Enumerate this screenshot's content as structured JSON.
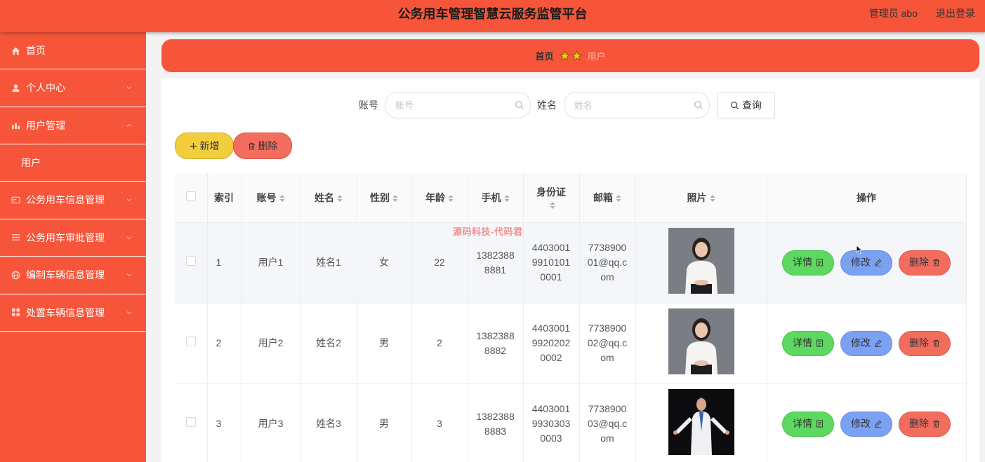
{
  "header": {
    "title": "公务用车管理智慧云服务监管平台",
    "user": "管理员 abo",
    "logout": "退出登录"
  },
  "sidebar": {
    "items": [
      {
        "label": "首页",
        "icon": "home-icon"
      },
      {
        "label": "个人中心",
        "icon": "user-icon"
      },
      {
        "label": "用户管理",
        "icon": "chart-icon"
      },
      {
        "label": "用户",
        "icon": ""
      },
      {
        "label": "公务用车信息管理",
        "icon": "card-icon"
      },
      {
        "label": "公务用车审批管理",
        "icon": "list-icon"
      },
      {
        "label": "编制车辆信息管理",
        "icon": "globe-icon"
      },
      {
        "label": "处置车辆信息管理",
        "icon": "grid-icon"
      }
    ]
  },
  "breadcrumb": {
    "home": "首页",
    "current": "用户"
  },
  "search": {
    "account_label": "账号",
    "account_placeholder": "账号",
    "name_label": "姓名",
    "name_placeholder": "姓名",
    "query_label": "查询"
  },
  "actions": {
    "add_label": "新增",
    "delete_label": "删除"
  },
  "table": {
    "headers": [
      "索引",
      "账号",
      "姓名",
      "性别",
      "年龄",
      "手机",
      "身份证",
      "邮箱",
      "照片",
      "操作"
    ],
    "op_labels": {
      "detail": "详情",
      "edit": "修改",
      "delete": "删除"
    },
    "rows": [
      {
        "index": "1",
        "account": "用户1",
        "name": "姓名1",
        "gender": "女",
        "age": "22",
        "phone": "13823888881",
        "id_card": "440300199101010001",
        "email": "773890001@qq.com"
      },
      {
        "index": "2",
        "account": "用户2",
        "name": "姓名2",
        "gender": "男",
        "age": "2",
        "phone": "13823888882",
        "id_card": "440300199202020002",
        "email": "773890002@qq.com"
      },
      {
        "index": "3",
        "account": "用户3",
        "name": "姓名3",
        "gender": "男",
        "age": "3",
        "phone": "13823888883",
        "id_card": "440300199303030003",
        "email": "773890003@qq.com"
      }
    ]
  },
  "watermark": "源码科技-代码君",
  "colors": {
    "primary": "#f6553a",
    "add": "#f2ce3c",
    "delete": "#f36d5e",
    "detail": "#5dd861",
    "edit": "#7ba1f2"
  }
}
